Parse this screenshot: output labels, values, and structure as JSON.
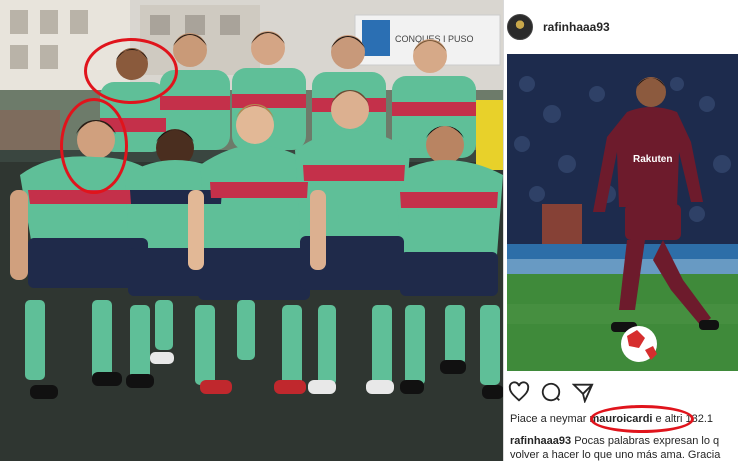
{
  "left_photo": {
    "description_colors": {
      "kit": "#5fbf98",
      "shorts": "#1f2a4a",
      "stripe": "#c4304a",
      "pitch": "#2f3631"
    },
    "background_sign_text": "CONQUES I PUSO"
  },
  "instagram": {
    "username": "rafinhaaa93",
    "likes_prefix": "Piace a neymar",
    "likes_highlight": "mauroicardi",
    "likes_suffix": "e altri 132.1",
    "caption_user": "rafinhaaa93",
    "caption_line1": "Pocas palabras expresan lo q",
    "caption_line2": "volver a hacer lo que uno más ama. Gracia",
    "jersey_sponsor": "Rakuten",
    "icons": [
      "heart-icon",
      "comment-icon",
      "share-icon"
    ]
  },
  "annotations": {
    "highlight_color": "#e0141c"
  }
}
